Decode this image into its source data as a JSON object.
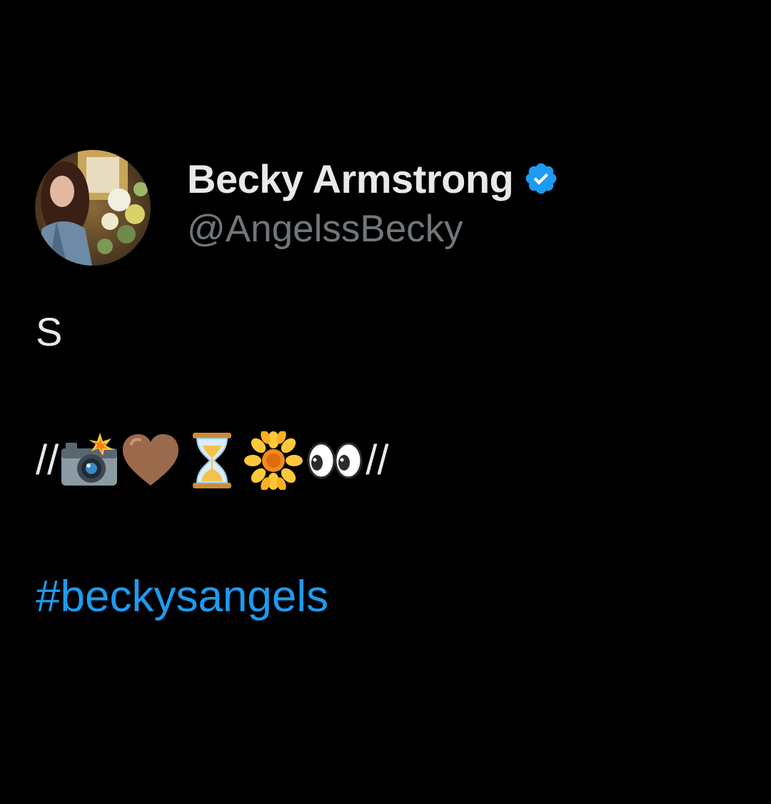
{
  "author": {
    "display_name": "Becky Armstrong",
    "handle": "@AngelssBecky",
    "verified": true
  },
  "tweet": {
    "line1": "S",
    "emoji_line": {
      "prefix": "//",
      "suffix": "//",
      "emojis": [
        "camera-with-flash",
        "brown-heart",
        "hourglass",
        "blossom",
        "eyes"
      ]
    },
    "hashtag": "#beckysangels"
  },
  "colors": {
    "background": "#000000",
    "primary_text": "#e7e9ea",
    "secondary_text": "#71767b",
    "link": "#1d9bf0",
    "verified_badge": "#1d9bf0"
  },
  "icons": {
    "verified": "verified-badge-icon",
    "avatar": "profile-photo"
  }
}
